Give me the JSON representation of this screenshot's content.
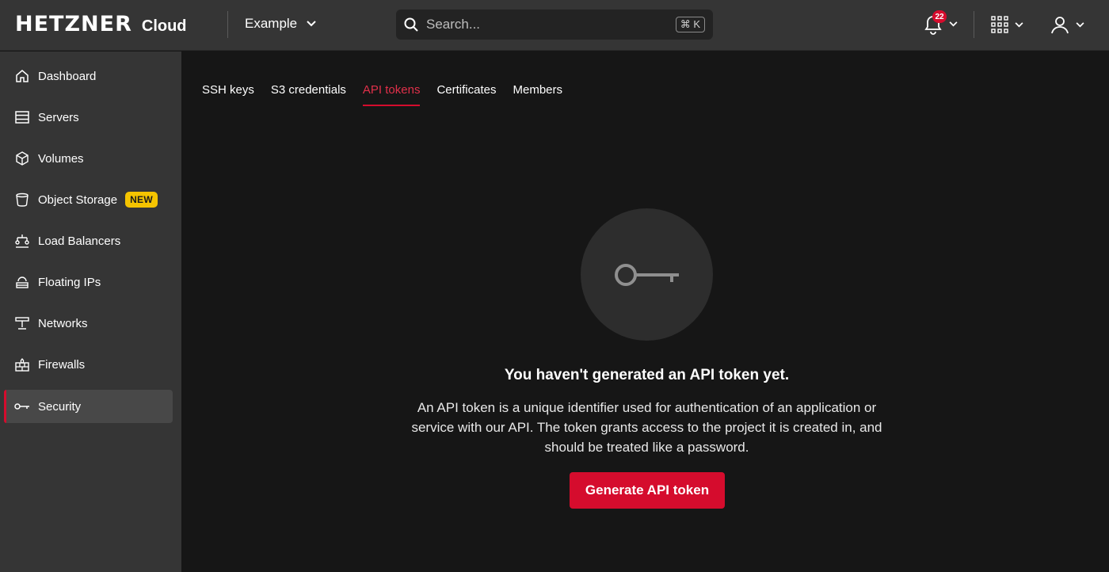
{
  "header": {
    "logo_text": "HETZNER",
    "logo_product": "Cloud",
    "project_name": "Example",
    "search_placeholder": "Search...",
    "search_shortcut": "⌘ K",
    "notification_count": "22"
  },
  "sidebar": {
    "items": [
      {
        "label": "Dashboard",
        "icon": "home-icon"
      },
      {
        "label": "Servers",
        "icon": "server-icon"
      },
      {
        "label": "Volumes",
        "icon": "cube-icon"
      },
      {
        "label": "Object Storage",
        "icon": "bucket-icon",
        "badge": "NEW"
      },
      {
        "label": "Load Balancers",
        "icon": "load-balancer-icon"
      },
      {
        "label": "Floating IPs",
        "icon": "floating-ip-icon"
      },
      {
        "label": "Networks",
        "icon": "network-icon"
      },
      {
        "label": "Firewalls",
        "icon": "firewall-icon"
      },
      {
        "label": "Security",
        "icon": "key-icon",
        "active": true
      }
    ]
  },
  "tabs": [
    {
      "label": "SSH keys"
    },
    {
      "label": "S3 credentials"
    },
    {
      "label": "API tokens",
      "active": true
    },
    {
      "label": "Certificates"
    },
    {
      "label": "Members"
    }
  ],
  "empty_state": {
    "icon": "key-icon",
    "title": "You haven't generated an API token yet.",
    "description": "An API token is a unique identifier used for authentication of an application or service with our API. The token grants access to the project it is created in, and should be treated like a password.",
    "button_label": "Generate API token"
  },
  "colors": {
    "accent": "#d50c2d",
    "new_badge": "#f5c400",
    "header_bg": "#353535",
    "main_bg": "#161616"
  }
}
